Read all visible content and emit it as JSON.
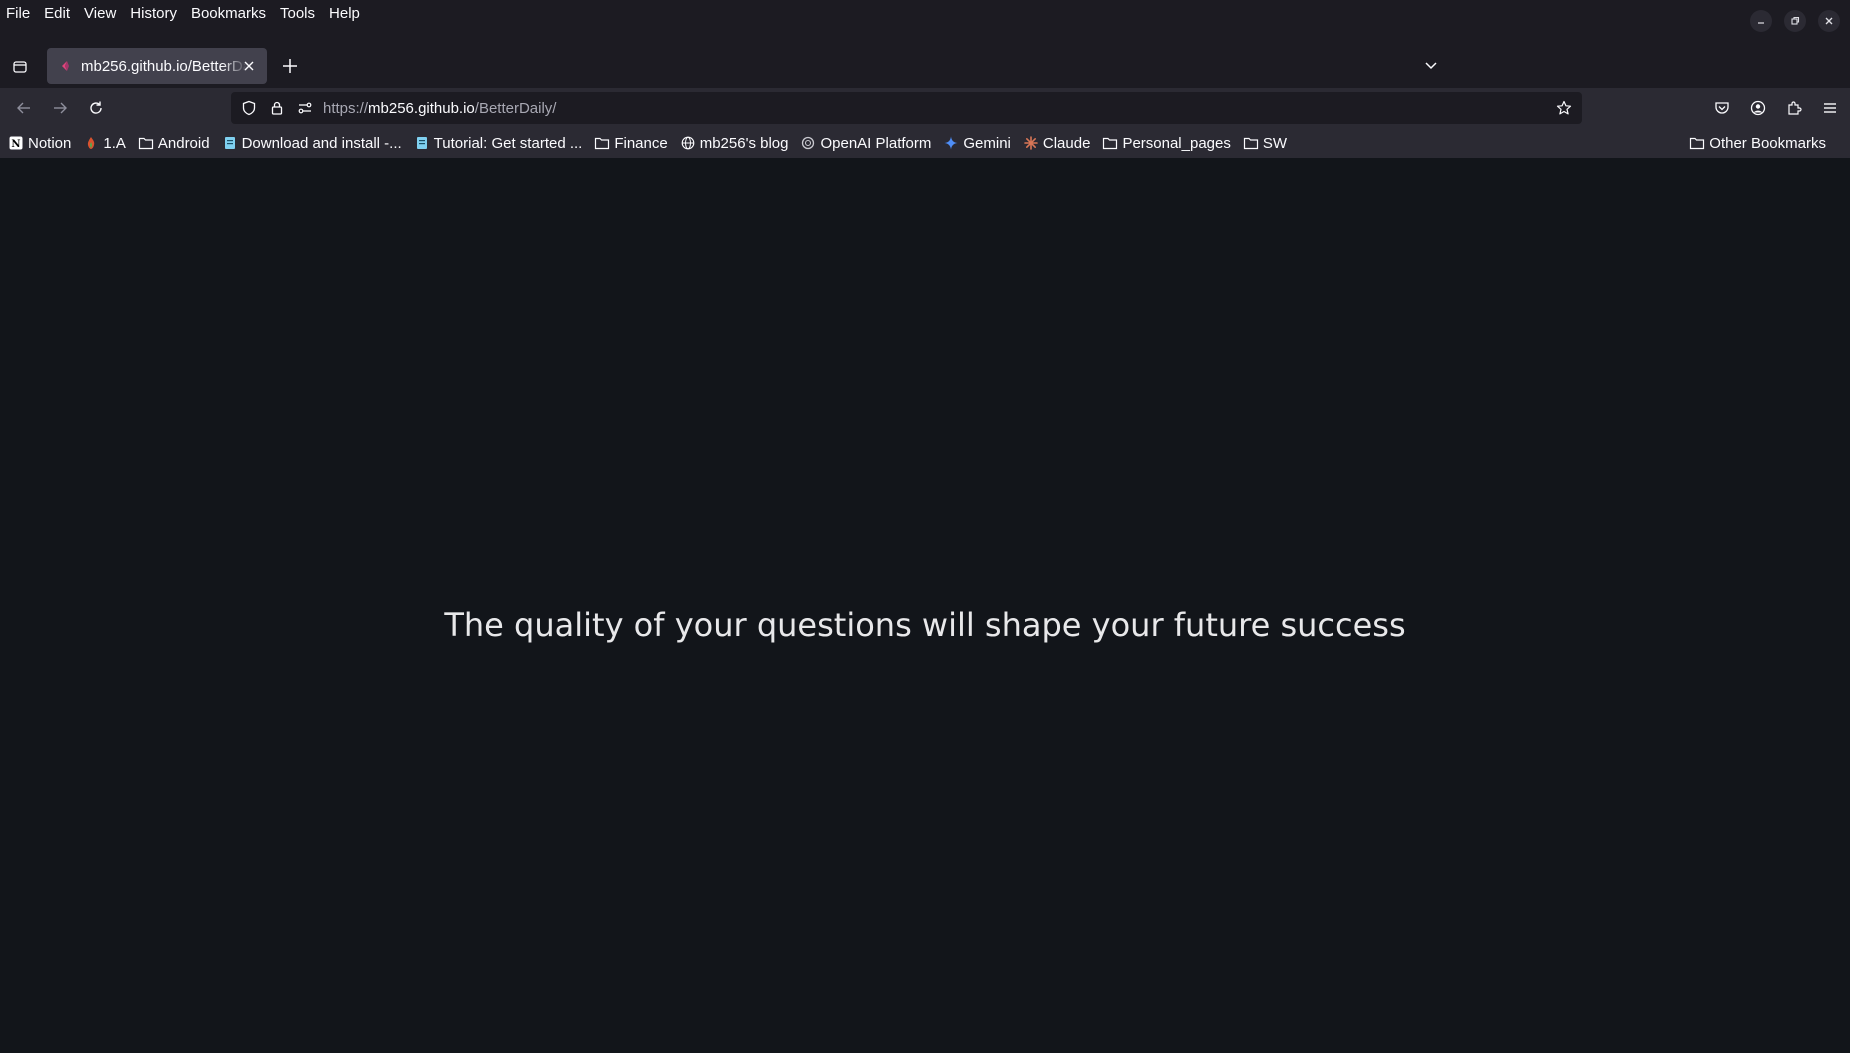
{
  "menubar": {
    "items": [
      {
        "label": "File"
      },
      {
        "label": "Edit"
      },
      {
        "label": "View"
      },
      {
        "label": "History"
      },
      {
        "label": "Bookmarks"
      },
      {
        "label": "Tools"
      },
      {
        "label": "Help"
      }
    ]
  },
  "tabs": [
    {
      "title": "mb256.github.io/BetterDaily",
      "icon": "better-daily-favicon"
    }
  ],
  "urlbar": {
    "url_scheme": "https://",
    "url_host": "mb256.github.io",
    "url_path": "/BetterDaily/"
  },
  "bookmarks": {
    "items": [
      {
        "label": "Notion",
        "icon": "notion-icon"
      },
      {
        "label": "1.A",
        "icon": "flame-icon"
      },
      {
        "label": "Android",
        "icon": "folder-icon"
      },
      {
        "label": "Download and install -...",
        "icon": "doc-icon"
      },
      {
        "label": "Tutorial: Get started ...",
        "icon": "doc-icon"
      },
      {
        "label": "Finance",
        "icon": "folder-icon"
      },
      {
        "label": "mb256's blog",
        "icon": "globe-icon"
      },
      {
        "label": "OpenAI Platform",
        "icon": "openai-icon"
      },
      {
        "label": "Gemini",
        "icon": "gemini-icon"
      },
      {
        "label": "Claude",
        "icon": "claude-icon"
      },
      {
        "label": "Personal_pages",
        "icon": "folder-icon"
      },
      {
        "label": "SW",
        "icon": "folder-icon"
      }
    ],
    "other_label": "Other Bookmarks"
  },
  "page": {
    "quote": "The quality of your questions will shape your future success"
  },
  "colors": {
    "page_background": "#12151a",
    "chrome_background": "#1c1b22",
    "toolbar_background": "#2b2a33"
  }
}
